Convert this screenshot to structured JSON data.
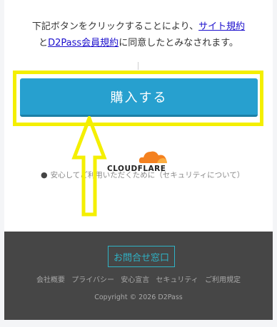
{
  "agreement": {
    "prefix": "下記ボタンをクリックすることにより、",
    "site_terms_link": "サイト規約",
    "middle": "と",
    "member_terms_link": "D2Pass会員規約",
    "suffix": "に同意したとみなされます。"
  },
  "purchase_button": {
    "label": "購入する"
  },
  "cloudflare": {
    "logo_text": "CLOUDFLARE",
    "icon": "cloud-icon"
  },
  "security_note": {
    "icon": "shield-lock-icon",
    "text": "安心してご利用いただくために（セキュリティについて）"
  },
  "annotation": {
    "highlight_color": "#f4ef00",
    "arrow_icon": "up-arrow-icon"
  },
  "footer": {
    "contact_button": "お問合せ窓口",
    "links": [
      "会社概要",
      "プライバシー",
      "安心宣言",
      "セキュリティ",
      "ご利用規定"
    ],
    "copyright": "Copyright © 2026 D2Pass"
  },
  "colors": {
    "button": "#27a0cf",
    "link": "#1a0dcc",
    "footer_bg": "#464646",
    "contact_accent": "#2fb3c6",
    "cloudflare_orange": "#f48120"
  }
}
